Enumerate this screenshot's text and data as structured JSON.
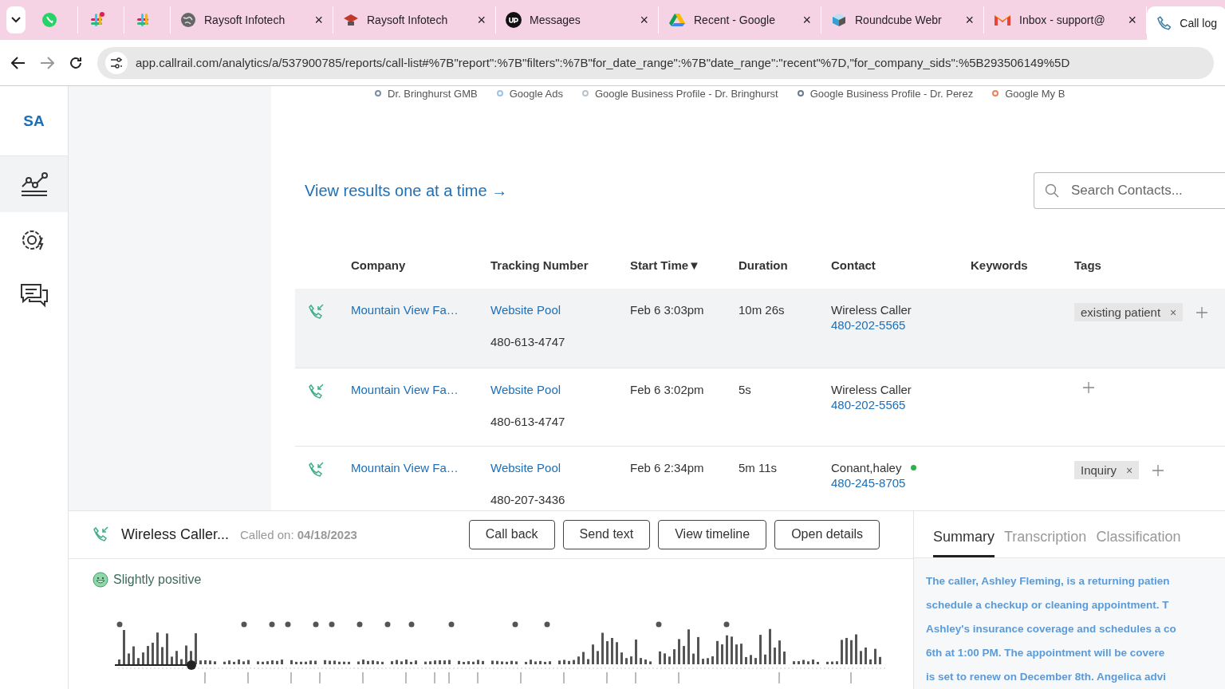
{
  "browser": {
    "tabs": [
      {
        "selected": false
      },
      {
        "selected": false
      },
      {
        "selected": false
      },
      {
        "title": "Raysoft Infotech",
        "selected": false,
        "close": "×"
      },
      {
        "title": "Raysoft Infotech",
        "selected": false,
        "close": "×"
      },
      {
        "title": "Messages",
        "selected": false,
        "close": "×"
      },
      {
        "title": "Recent - Google",
        "selected": false,
        "close": "×"
      },
      {
        "title": "Roundcube Webr",
        "selected": false,
        "close": "×"
      },
      {
        "title": "Inbox - support@",
        "selected": false,
        "close": "×"
      },
      {
        "title": "Call log",
        "selected": true
      }
    ],
    "url": "app.callrail.com/analytics/a/537900785/reports/call-list#%7B\"report\":%7B\"filters\":%7B\"for_date_range\":%7B\"date_range\":\"recent\"%7D,\"for_company_sids\":%5B293506149%5D"
  },
  "sidebar": {
    "account": "SA",
    "items": [
      {
        "selected": true
      },
      {
        "selected": false
      },
      {
        "selected": false
      }
    ]
  },
  "legend": [
    {
      "label": "Dr. Bringhurst GMB",
      "color": "#7a8fa8"
    },
    {
      "label": "Google Ads",
      "color": "#9cc3e6"
    },
    {
      "label": "Google Business Profile - Dr. Bringhurst",
      "color": "#b8c4d0"
    },
    {
      "label": "Google Business Profile - Dr. Perez",
      "color": "#6b7a8a"
    },
    {
      "label": "Google My B",
      "color": "#e8845c"
    }
  ],
  "view_link": "View results one at a time →",
  "search": {
    "placeholder": "Search Contacts..."
  },
  "table": {
    "columns": [
      "Company",
      "Tracking Number",
      "Start Time▼",
      "Duration",
      "Contact",
      "Keywords",
      "Tags"
    ],
    "rows": [
      {
        "selected": true,
        "company": "Mountain View Fa…",
        "source": "Website Pool",
        "number": "480-613-4747",
        "start": "Feb 6 3:03pm",
        "duration": "10m 26s",
        "contact": "Wireless Caller",
        "online": false,
        "phone": "480-202-5565",
        "tags": [
          {
            "label": "existing patient",
            "remove": "×"
          }
        ]
      },
      {
        "selected": false,
        "company": "Mountain View Fa…",
        "source": "Website Pool",
        "number": "480-613-4747",
        "start": "Feb 6 3:02pm",
        "duration": "5s",
        "contact": "Wireless Caller",
        "online": false,
        "phone": "480-202-5565",
        "tags": []
      },
      {
        "selected": false,
        "company": "Mountain View Fa…",
        "source": "Website Pool",
        "number": "480-207-3436",
        "start": "Feb 6 2:34pm",
        "duration": "5m 11s",
        "contact": "Conant,haley",
        "online": true,
        "phone": "480-245-8705",
        "tags": [
          {
            "label": "Inquiry",
            "remove": "×"
          }
        ]
      }
    ]
  },
  "detail": {
    "caller": "Wireless Caller...",
    "called_on_label": "Called on:",
    "called_on": "04/18/2023",
    "buttons": [
      "Call back",
      "Send text",
      "View timeline",
      "Open details"
    ],
    "sentiment": "Slightly positive",
    "player": {
      "level": 0.1
    },
    "tabs": [
      {
        "label": "Summary",
        "selected": true
      },
      {
        "label": "Transcription",
        "selected": false
      },
      {
        "label": "Classification",
        "selected": false
      }
    ],
    "summary_lines": [
      "The caller, Ashley Fleming, is a returning patien",
      "schedule a checkup or cleaning appointment. T",
      "Ashley's insurance coverage and schedules a co",
      "6th at 1:00 PM. The appointment will be covere",
      "is set to renew on December 8th. Angelica advi"
    ]
  }
}
